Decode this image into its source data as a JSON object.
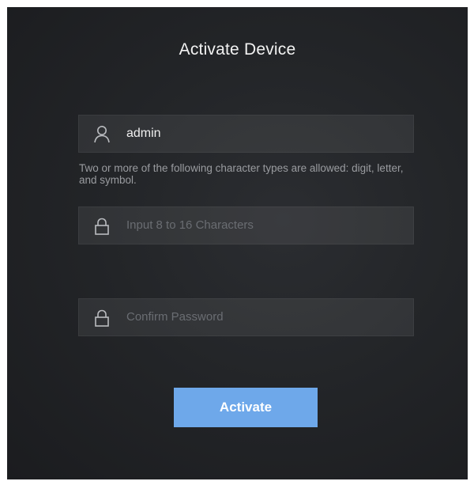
{
  "dialog": {
    "title": "Activate Device"
  },
  "username": {
    "value": "admin",
    "icon": "user-icon"
  },
  "hint": {
    "text": "Two or more of the following character types are allowed: digit, letter, and symbol."
  },
  "password": {
    "placeholder": "Input 8 to 16 Characters",
    "value": "",
    "icon": "lock-icon"
  },
  "confirm_password": {
    "placeholder": "Confirm Password",
    "value": "",
    "icon": "lock-icon"
  },
  "actions": {
    "activate_label": "Activate"
  },
  "colors": {
    "accent": "#6ea8ea",
    "panel_bg": "#232528",
    "field_bg": "#2f3134"
  }
}
